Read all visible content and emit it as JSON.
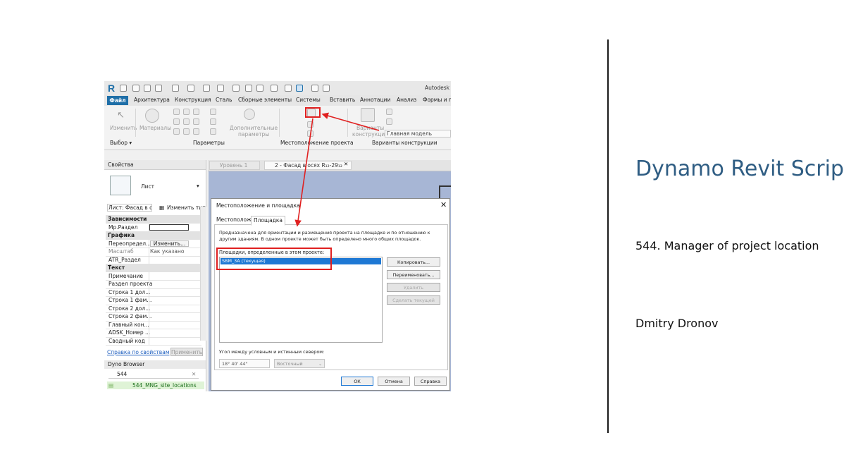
{
  "slide": {
    "title": "Dynamo Revit Script",
    "subtitle": "544. Manager of project location",
    "author": "Dmitry Dronov",
    "title_color": "#2f5d83"
  },
  "revit": {
    "app_title": "Autodesk",
    "logo": "R",
    "tabs": [
      "Файл",
      "Архитектура",
      "Конструкция",
      "Сталь",
      "Сборные элементы",
      "Системы",
      "Вставить",
      "Аннотации",
      "Анализ",
      "Формы и г"
    ],
    "ribbon": {
      "modify": "Изменить",
      "materials": "Материалы",
      "additional_params_1": "Дополнительные",
      "additional_params_2": "параметры",
      "design_options_1": "Варианты",
      "design_options_2": "конструкции",
      "main_model": "Главная модель",
      "panel_select": "Выбор ▾",
      "panel_params": "Параметры",
      "panel_location": "Местоположение проекта",
      "panel_design_options": "Варианты конструкции"
    },
    "properties": {
      "header": "Свойства",
      "type_name": "Лист",
      "instance_filter": "Лист: Фасад в с",
      "edit_type": "Изменить тип",
      "rows": [
        {
          "kind": "cat",
          "label": "Зависимости"
        },
        {
          "kind": "row",
          "key": "Мр.Раздел",
          "value": ""
        },
        {
          "kind": "cat",
          "label": "Графика"
        },
        {
          "kind": "row",
          "key": "Переопредел...",
          "value": "Изменить..."
        },
        {
          "kind": "row",
          "key": "Масштаб",
          "value": "Как указано"
        },
        {
          "kind": "row",
          "key": "ATR_Раздел",
          "value": ""
        },
        {
          "kind": "cat",
          "label": "Текст"
        },
        {
          "kind": "row",
          "key": "Примечание",
          "value": ""
        },
        {
          "kind": "row",
          "key": "Раздел проекта",
          "value": ""
        },
        {
          "kind": "row",
          "key": "Строка 1 дол...",
          "value": ""
        },
        {
          "kind": "row",
          "key": "Строка 1 фам...",
          "value": ""
        },
        {
          "kind": "row",
          "key": "Строка 2 дол...",
          "value": ""
        },
        {
          "kind": "row",
          "key": "Строка 2 фам...",
          "value": ""
        },
        {
          "kind": "row",
          "key": "Главный кон...",
          "value": ""
        },
        {
          "kind": "row",
          "key": "ADSK_Номер ...",
          "value": ""
        },
        {
          "kind": "row",
          "key": "Сводный код",
          "value": ""
        }
      ],
      "help_link": "Справка по свойствам",
      "apply": "Применить"
    },
    "dyno": {
      "header": "Dyno Browser",
      "search_value": "544",
      "item": "544_MNG_site_locations"
    },
    "view_tabs": [
      "Уровень 1",
      "2 - Фасад в осях R₁₂-29₁₂"
    ],
    "dialog": {
      "title": "Местоположение и площадка",
      "tabs": [
        "Местоположение",
        "Площадка"
      ],
      "description": "Предназначена для ориентации и размещения проекта на площадке и по отношению к другим зданиям. В одном проекте может быть определено много общих площадок.",
      "list_label": "Площадки, определенные в этом проекте:",
      "sites": [
        "SBM_3A (текущая)"
      ],
      "buttons": [
        "Копировать...",
        "Переименовать...",
        "Удалить",
        "Сделать текущей"
      ],
      "angle_label": "Угол между условным и истинным севером:",
      "angle_value": "18° 40' 44\"",
      "angle_direction": "Восточный",
      "ok": "ОК",
      "cancel": "Отмена",
      "help": "Справка"
    }
  }
}
